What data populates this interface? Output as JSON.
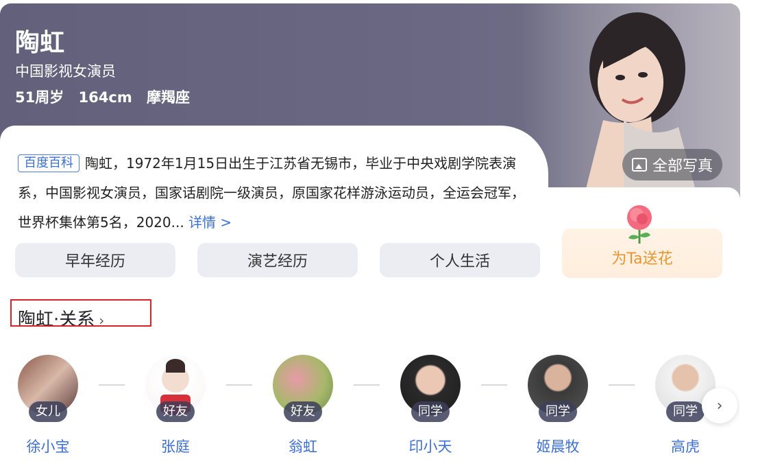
{
  "header": {
    "name": "陶虹",
    "subtitle": "中国影视女演员",
    "meta": [
      "51周岁",
      "164cm",
      "摩羯座"
    ],
    "photos_button": "全部写真"
  },
  "bio": {
    "source_badge": "百度百科",
    "text": "陶虹，1972年1月15日出生于江苏省无锡市，毕业于中央戏剧学院表演系，中国影视女演员，国家话剧院一级演员，原国家花样游泳运动员，全运会冠军，世界杯集体第5名，2020...",
    "more_link": "详情 >"
  },
  "tabs": [
    "早年经历",
    "演艺经历",
    "个人生活"
  ],
  "flower_button": "为Ta送花",
  "relations": {
    "title": "陶虹·关系",
    "chevron": "›",
    "people": [
      {
        "relation": "女儿",
        "name": "徐小宝"
      },
      {
        "relation": "好友",
        "name": "张庭"
      },
      {
        "relation": "好友",
        "name": "翁虹"
      },
      {
        "relation": "同学",
        "name": "印小天"
      },
      {
        "relation": "同学",
        "name": "姬晨牧"
      },
      {
        "relation": "同学",
        "name": "高虎"
      }
    ],
    "next_icon": "›"
  },
  "colors": {
    "header_bg": "#62607a",
    "link_blue": "#3b6fd4",
    "flower_text": "#e8962f",
    "highlight_red": "#d8232a"
  }
}
